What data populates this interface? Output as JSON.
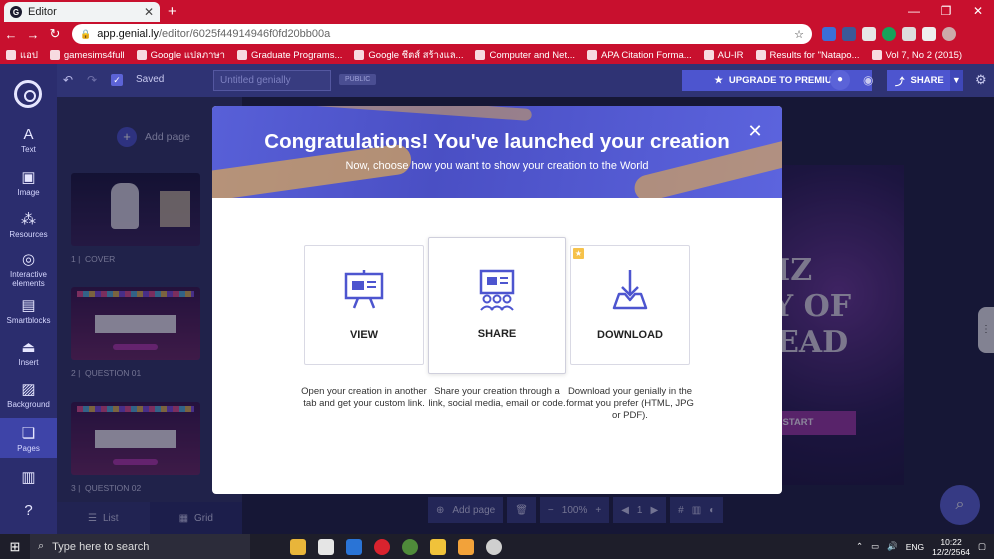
{
  "browser": {
    "tab_title": "Editor",
    "tab_icon": "G",
    "url_domain": "app.genial.ly",
    "url_path": "/editor/6025f44914946f0fd20bb00a",
    "bookmarks": [
      "แอป",
      "gamesims4full",
      "Google แปลภาษา",
      "Graduate Programs...",
      "Google ชีตส์ สร้างแล...",
      "Computer and Net...",
      "APA Citation Forma...",
      "AU-IR",
      "Results for \"Natapo...",
      "Vol 7, No 2 (2015)"
    ]
  },
  "editor": {
    "saved_label": "Saved",
    "title_placeholder": "Untitled genially",
    "public_badge": "PUBLIC",
    "upgrade_label": "UPGRADE TO PREMIUM",
    "share_label": "SHARE",
    "rail": [
      {
        "label": "Text",
        "icon": "text-icon"
      },
      {
        "label": "Image",
        "icon": "image-icon"
      },
      {
        "label": "Resources",
        "icon": "resources-icon"
      },
      {
        "label": "Interactive elements",
        "icon": "interactive-icon"
      },
      {
        "label": "Smartblocks",
        "icon": "smartblocks-icon"
      },
      {
        "label": "Insert",
        "icon": "insert-icon"
      },
      {
        "label": "Background",
        "icon": "background-icon"
      },
      {
        "label": "Pages",
        "icon": "pages-icon"
      }
    ],
    "add_page_label": "Add page",
    "pages": [
      {
        "num": "1",
        "label": "COVER"
      },
      {
        "num": "2",
        "label": "QUESTION 01"
      },
      {
        "num": "3",
        "label": "QUESTION 02"
      }
    ],
    "list_label": "List",
    "grid_label": "Grid",
    "slide_big_text": "UIZ\nAY OF\nDEAD",
    "slide_start": "START",
    "bottom_add_page": "Add page",
    "zoom": "100%",
    "page_number": "1"
  },
  "modal": {
    "title": "Congratulations! You've launched your creation",
    "subtitle": "Now, choose how you want to show your creation to the World",
    "options": [
      {
        "label": "VIEW",
        "icon": "presentation-board-icon",
        "desc": "Open your creation in another tab and get your custom link."
      },
      {
        "label": "SHARE",
        "icon": "share-audience-icon",
        "desc": "Share your creation through a link, social media, email or code."
      },
      {
        "label": "DOWNLOAD",
        "icon": "download-tray-icon",
        "desc": "Download your genially in the format you prefer (HTML, JPG or PDF)."
      }
    ]
  },
  "taskbar": {
    "search_placeholder": "Type here to search",
    "lang": "ENG",
    "time": "10:22",
    "date": "12/2/2564"
  },
  "colors": {
    "browser_red": "#c8102e",
    "genially_blue": "#4d55cf",
    "rail_bg": "#2b2d6e"
  }
}
